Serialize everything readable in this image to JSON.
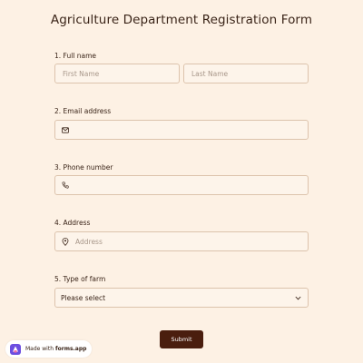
{
  "form": {
    "title": "Agriculture Department Registration Form",
    "questions": {
      "full_name": {
        "label": "1. Full name",
        "first_placeholder": "First Name",
        "last_placeholder": "Last Name"
      },
      "email": {
        "label": "2. Email address",
        "icon": "mail-icon",
        "value": ""
      },
      "phone": {
        "label": "3. Phone number",
        "icon": "phone-icon",
        "value": ""
      },
      "address": {
        "label": "4. Address",
        "icon": "location-pin-icon",
        "placeholder": "Address"
      },
      "farm_type": {
        "label": "5. Type of farm",
        "selected": "Please select"
      }
    },
    "submit_label": "Submit"
  },
  "branding": {
    "made_with": "Made with",
    "brand": "forms.app"
  },
  "colors": {
    "background": "#fdf1e4",
    "field_border": "#dcc3ac",
    "submit_bg": "#4a1e0e",
    "text": "#3a2418"
  }
}
